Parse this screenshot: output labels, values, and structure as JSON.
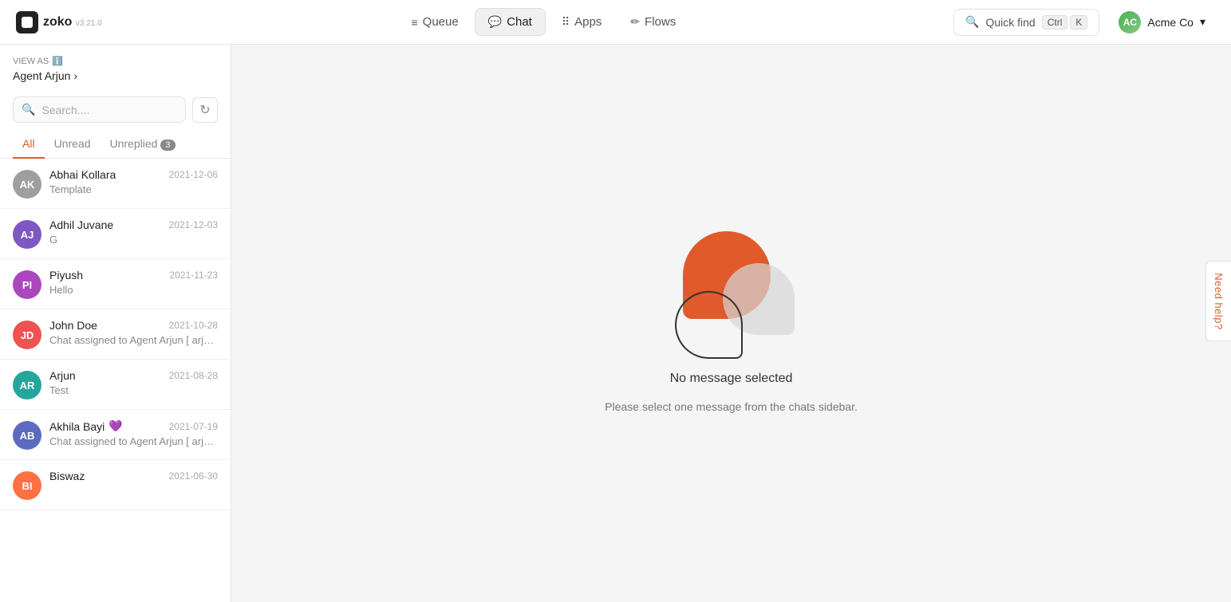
{
  "app": {
    "name": "zoko",
    "version": "v3.21.0"
  },
  "topnav": {
    "queue_label": "Queue",
    "chat_label": "Chat",
    "apps_label": "Apps",
    "flows_label": "Flows",
    "quick_find_label": "Quick find",
    "kbd_ctrl": "Ctrl",
    "kbd_k": "K",
    "workspace_name": "Acme Co",
    "workspace_initials": "AC"
  },
  "sidebar": {
    "view_as_label": "VIEW AS",
    "info_icon": "ℹ",
    "agent_name": "Agent Arjun",
    "search_placeholder": "Search....",
    "tabs": [
      {
        "label": "All",
        "active": true,
        "badge": null
      },
      {
        "label": "Unread",
        "active": false,
        "badge": null
      },
      {
        "label": "Unreplied",
        "active": false,
        "badge": "3"
      }
    ],
    "chats": [
      {
        "initials": "AK",
        "avatar_color": "#9E9E9E",
        "name": "Abhai Kollara",
        "date": "2021-12-06",
        "preview": "Template"
      },
      {
        "initials": "AJ",
        "avatar_color": "#7E57C2",
        "name": "Adhil Juvane",
        "date": "2021-12-03",
        "preview": "G"
      },
      {
        "initials": "PI",
        "avatar_color": "#AB47BC",
        "name": "Piyush",
        "date": "2021-11-23",
        "preview": "Hello"
      },
      {
        "initials": "JD",
        "avatar_color": "#EF5350",
        "name": "John Doe",
        "date": "2021-10-28",
        "preview": "Chat assigned to Agent Arjun [ arjun..."
      },
      {
        "initials": "AR",
        "avatar_color": "#26A69A",
        "name": "Arjun",
        "date": "2021-08-28",
        "preview": "Test"
      },
      {
        "initials": "AB",
        "avatar_color": "#5C6BC0",
        "name": "Akhila Bayi",
        "heart": "💜",
        "date": "2021-07-19",
        "preview": "Chat assigned to Agent Arjun [ arjun..."
      },
      {
        "initials": "BI",
        "avatar_color": "#FF7043",
        "name": "Biswaz",
        "date": "2021-06-30",
        "preview": ""
      }
    ]
  },
  "empty_state": {
    "title": "No message selected",
    "subtitle": "Please select one message from the\nchats sidebar."
  },
  "need_help": {
    "label": "Need help?"
  }
}
